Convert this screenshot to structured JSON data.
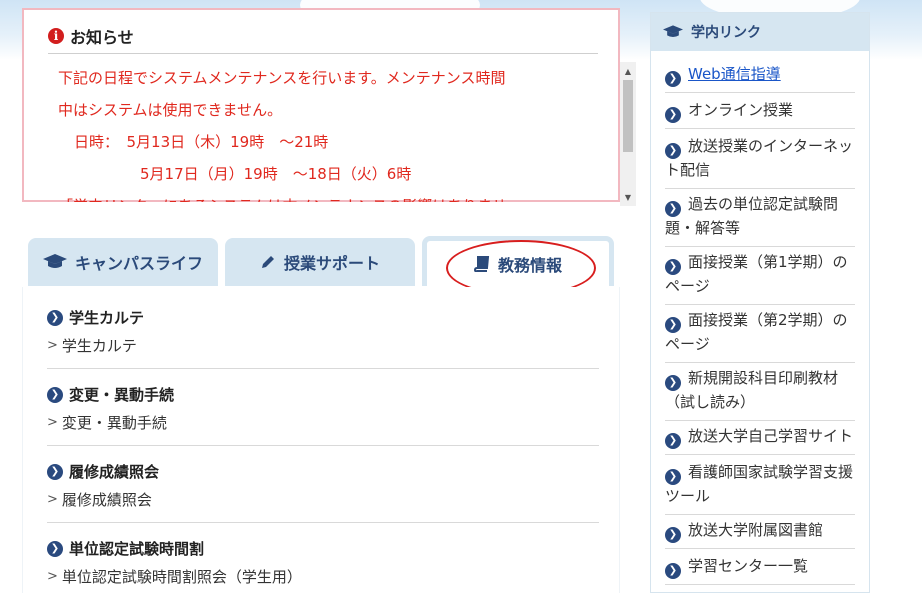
{
  "notice": {
    "title": "お知らせ",
    "icon": "info-icon",
    "lines": [
      "下記の日程でシステムメンテナンスを行います。メンテナンス時間",
      "中はシステムは使用できません。",
      "日時：　5月13日（木）19時　～21時",
      "5月17日（月）19時　～18日（火）6時",
      "「学内リンク」にあるシステムは本メンテナンスの影響はありませ"
    ],
    "text_color": "#e0281e"
  },
  "tabs": [
    {
      "label": "キャンパスライフ",
      "icon": "graduation-cap-icon",
      "active": false
    },
    {
      "label": "授業サポート",
      "icon": "pencil-icon",
      "active": false
    },
    {
      "label": "教務情報",
      "icon": "book-icon",
      "active": true
    }
  ],
  "sections": [
    {
      "title": "学生カルテ",
      "link": "学生カルテ"
    },
    {
      "title": "変更・異動手続",
      "link": "変更・異動手続"
    },
    {
      "title": "履修成績照会",
      "link": "履修成績照会"
    },
    {
      "title": "単位認定試験時間割",
      "link": "単位認定試験時間割照会（学生用）"
    }
  ],
  "sidebar": {
    "title": "学内リンク",
    "items": [
      {
        "lines": [
          "Web通信指導"
        ],
        "is_link": true
      },
      {
        "lines": [
          "オンライン授業"
        ]
      },
      {
        "lines": [
          "放送授業のインターネッ",
          "ト配信"
        ]
      },
      {
        "lines": [
          "過去の単位認定試験問",
          "題・解答等"
        ]
      },
      {
        "lines": [
          "面接授業（第1学期）の",
          "ページ"
        ]
      },
      {
        "lines": [
          "面接授業（第2学期）の",
          "ページ"
        ]
      },
      {
        "lines": [
          "新規開設科目印刷教材",
          "（試し読み）"
        ]
      },
      {
        "lines": [
          "放送大学自己学習サイト"
        ]
      },
      {
        "lines": [
          "看護師国家試験学習支援",
          "ツール"
        ]
      },
      {
        "lines": [
          "放送大学附属図書館"
        ]
      },
      {
        "lines": [
          "学習センター一覧"
        ]
      }
    ]
  },
  "colors": {
    "accent": "#2a4a7f",
    "tab_bg": "#d6e6f1",
    "notice_border": "#f2b8c0",
    "highlight": "#d81e1e"
  }
}
